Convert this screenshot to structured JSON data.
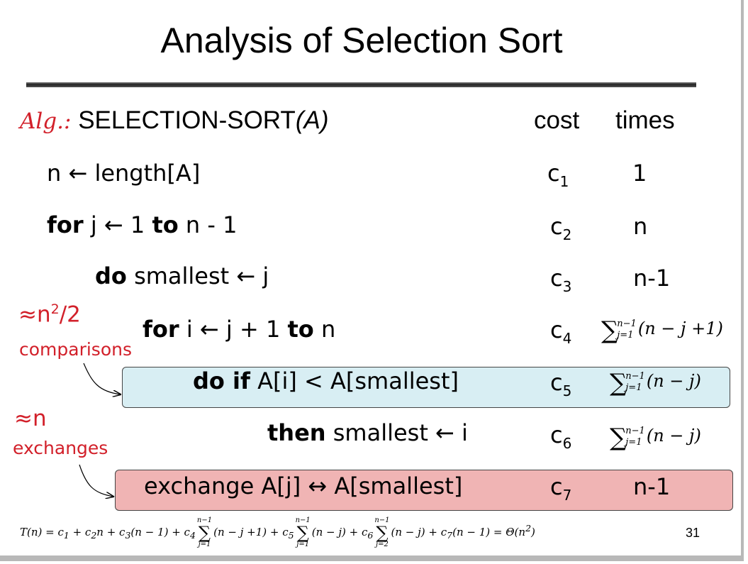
{
  "slide": {
    "title": "Analysis of Selection Sort",
    "alg_label": "Alg.:",
    "alg_name": "SELECTION-SORT",
    "alg_param": "(A)",
    "col_cost": "cost",
    "col_times": "times",
    "page_number": "31"
  },
  "rows": [
    {
      "kw1": "",
      "t1": "n ← length[A]",
      "kw2": "",
      "t2": "",
      "cost_c": "c",
      "cost_sub": "1",
      "times": "1"
    },
    {
      "kw1": "for",
      "t1": " j ← 1 ",
      "kw2": "to",
      "t2": " n - 1",
      "cost_c": "c",
      "cost_sub": "2",
      "times": "n"
    },
    {
      "kw1": "do",
      "t1": " smallest ← j",
      "kw2": "",
      "t2": "",
      "cost_c": "c",
      "cost_sub": "3",
      "times": "n-1"
    },
    {
      "kw1": "for",
      "t1": " i ← j + 1 ",
      "kw2": "to",
      "t2": " n",
      "cost_c": "c",
      "cost_sub": "4",
      "times_sum_top": "n−1",
      "times_sum_bot": "j=1",
      "times_sum_expr": "(n − j +1)"
    },
    {
      "kw1": "do if",
      "t1": " A[i] < A[smallest]",
      "kw2": "",
      "t2": "",
      "cost_c": "c",
      "cost_sub": "5",
      "times_sum_top": "n−1",
      "times_sum_bot": "j=1",
      "times_sum_expr": "(n − j)"
    },
    {
      "kw1": "then",
      "t1": " smallest ← i",
      "kw2": "",
      "t2": "",
      "cost_c": "c",
      "cost_sub": "6",
      "times_sum_top": "n−1",
      "times_sum_bot": "j=1",
      "times_sum_expr": "(n − j)"
    },
    {
      "kw1": "",
      "t1": "exchange A[j] ↔ A[smallest]",
      "kw2": "",
      "t2": "",
      "cost_c": "c",
      "cost_sub": "7",
      "times": "n-1"
    }
  ],
  "annotations": {
    "comp_approx": "≈n",
    "comp_sup": "2",
    "comp_div": "/2",
    "comp_label": "comparisons",
    "exch_approx": "≈n",
    "exch_label": "exchanges"
  },
  "formula": {
    "lhs": "T(n) = c",
    "p1": " + c",
    "p2": "n + c",
    "p3": "(n − 1) + c",
    "s1_top": "n−1",
    "s1_bot": "j=1",
    "s1_expr": "(n − j +1) + c",
    "s2_top": "n−1",
    "s2_bot": "j=1",
    "s2_expr": "(n − j) + c",
    "s3_top": "n−1",
    "s3_bot": "j=2",
    "s3_expr": "(n − j) + c",
    "tail": "(n − 1) = Θ(n",
    "tail_sup": "2",
    "tail_end": ")",
    "sig": "∑",
    "subs": [
      "1",
      "2",
      "3",
      "4",
      "5",
      "6",
      "7"
    ]
  }
}
